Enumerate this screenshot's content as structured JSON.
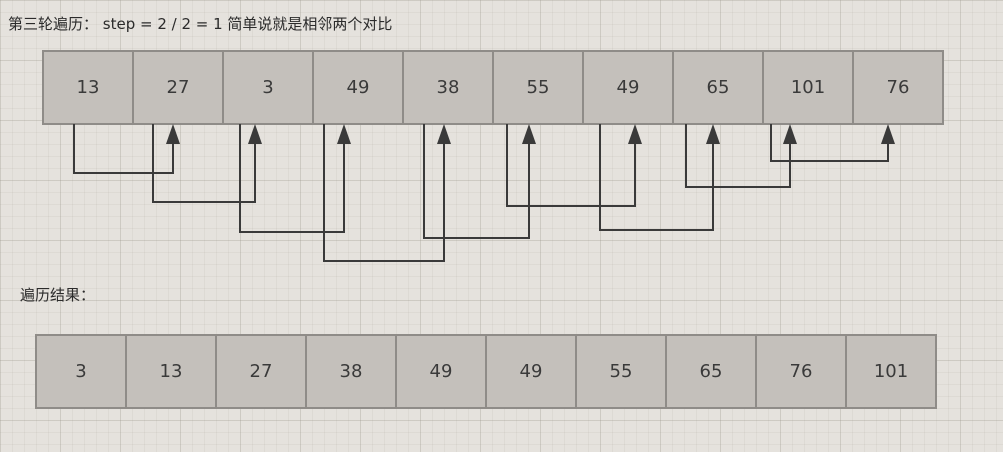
{
  "round_title": "第三轮遍历： step = 2 / 2 = 1 简单说就是相邻两个对比",
  "before": [
    "13",
    "27",
    "3",
    "49",
    "38",
    "55",
    "49",
    "65",
    "101",
    "76"
  ],
  "result_title": "遍历结果：",
  "after": [
    "3",
    "13",
    "27",
    "38",
    "49",
    "49",
    "55",
    "65",
    "76",
    "101"
  ],
  "connector_color": "#3a3a3a",
  "cell_fill": "#c4c0bb",
  "cell_border": "#8f8c88"
}
